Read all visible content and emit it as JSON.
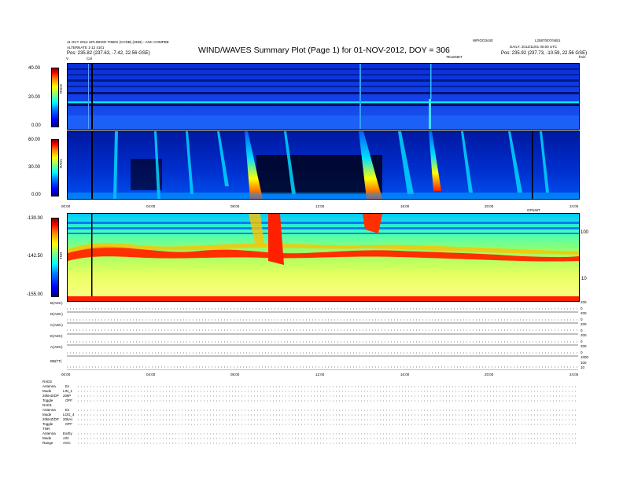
{
  "header": {
    "left_line1": "11 OCT 2012 UPLINKED TIMES (CCDB) (SDB) - ANC COMPBE",
    "left_line2": "ALTERNATE 1-12 4101",
    "right_line1": "WPIOO3440",
    "right_line2": "L25870/07/n8b1",
    "title": "WIND/WAVES Summary Plot (Page 1) for 01-NOV-2012, DOY = 306",
    "left_pos": "Pos:   235.82 (237.63, -7.42, 22.56 GSE)",
    "right_daily": "DAILY: 2012/11/01 00:00 UTC",
    "right_pos": "Pos:   235.92 (237.73, -10.59, 22.56 GSE)",
    "left_marker": "V",
    "cal_marker": "Cal",
    "center_label": "TELEMET",
    "right_marker": "fmin"
  },
  "rad2": {
    "label": "RAD2",
    "ticks": [
      "40.00",
      "20.00",
      "0.00"
    ]
  },
  "rad1": {
    "label": "RAD1",
    "ticks": [
      "60.00",
      "30.00",
      "0.00"
    ]
  },
  "tnr": {
    "label": "TNR",
    "ticks": [
      "-130.00",
      "-142.50",
      "-155.00"
    ],
    "right_ticks": [
      "100",
      "10"
    ],
    "corner_label": "GFNINT"
  },
  "time_axis_top": [
    "00:00",
    "04:00",
    "08:00",
    "12:00",
    "16:00",
    "20:00",
    "24:00"
  ],
  "time_axis_bottom": [
    "00:00",
    "04:00",
    "08:00",
    "12:00",
    "16:00",
    "20:00",
    "24:00"
  ],
  "hk_rows": [
    {
      "label": "B(ADC)",
      "right": [
        "200",
        "0"
      ]
    },
    {
      "label": "D(ADC)",
      "right": [
        "200",
        "0"
      ]
    },
    {
      "label": "C(ADC)",
      "right": [
        "200",
        "0"
      ]
    },
    {
      "label": "E(ADC)",
      "right": [
        "200",
        "0"
      ]
    },
    {
      "label": "A(ADC)",
      "right": [
        "200",
        "0"
      ]
    },
    {
      "label": "BB(TT)",
      "right": [
        "1000",
        "100",
        "10"
      ]
    }
  ],
  "status_rows": [
    {
      "label": "RAD2",
      "value": ""
    },
    {
      "label": "Antenna",
      "value": "Ex"
    },
    {
      "label": "Mode",
      "value": "LIN_1"
    },
    {
      "label": "20kHZ/DP",
      "value": "20kP"
    },
    {
      "label": "Toggle",
      "value": "OFF"
    },
    {
      "label": "RAD1",
      "value": ""
    },
    {
      "label": "Antenna",
      "value": "Ex"
    },
    {
      "label": "Mode",
      "value": "LOG_4"
    },
    {
      "label": "20kHZ/DP",
      "value": "20kAc"
    },
    {
      "label": "Toggle",
      "value": "OFF"
    },
    {
      "label": "TNR",
      "value": ""
    },
    {
      "label": "Antenna",
      "value": "Ex/Ey"
    },
    {
      "label": "Mode",
      "value": "A/D"
    },
    {
      "label": "Range",
      "value": "AGC"
    }
  ],
  "colors": {
    "background_low": "#0020c0",
    "burst_high": "#ff0000",
    "tnr_base": "#f0ff60"
  }
}
